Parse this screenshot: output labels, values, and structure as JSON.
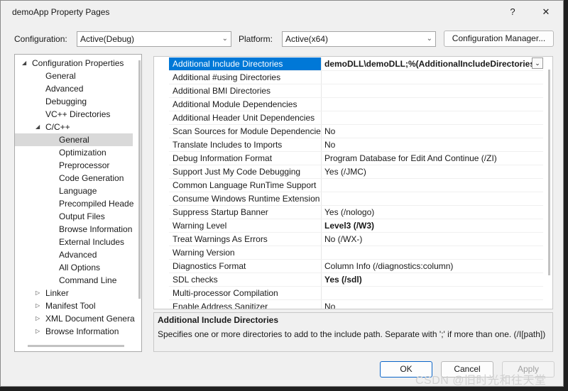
{
  "window": {
    "title": "demoApp Property Pages",
    "help_glyph": "?",
    "close_glyph": "✕"
  },
  "top": {
    "configuration_label": "Configuration:",
    "configuration_value": "Active(Debug)",
    "platform_label": "Platform:",
    "platform_value": "Active(x64)",
    "config_manager_label": "Configuration Manager..."
  },
  "tree": [
    {
      "label": "Configuration Properties",
      "level": 0,
      "expander": "down"
    },
    {
      "label": "General",
      "level": 1
    },
    {
      "label": "Advanced",
      "level": 1
    },
    {
      "label": "Debugging",
      "level": 1
    },
    {
      "label": "VC++ Directories",
      "level": 1
    },
    {
      "label": "C/C++",
      "level": 1,
      "expander": "down"
    },
    {
      "label": "General",
      "level": 2,
      "selected": true
    },
    {
      "label": "Optimization",
      "level": 2
    },
    {
      "label": "Preprocessor",
      "level": 2
    },
    {
      "label": "Code Generation",
      "level": 2
    },
    {
      "label": "Language",
      "level": 2
    },
    {
      "label": "Precompiled Heade",
      "level": 2
    },
    {
      "label": "Output Files",
      "level": 2
    },
    {
      "label": "Browse Information",
      "level": 2
    },
    {
      "label": "External Includes",
      "level": 2
    },
    {
      "label": "Advanced",
      "level": 2
    },
    {
      "label": "All Options",
      "level": 2
    },
    {
      "label": "Command Line",
      "level": 2
    },
    {
      "label": "Linker",
      "level": 1,
      "expander": "right"
    },
    {
      "label": "Manifest Tool",
      "level": 1,
      "expander": "right"
    },
    {
      "label": "XML Document Genera",
      "level": 1,
      "expander": "right"
    },
    {
      "label": "Browse Information",
      "level": 1,
      "expander": "right"
    }
  ],
  "properties": [
    {
      "name": "Additional Include Directories",
      "value": "demoDLL\\demoDLL;%(AdditionalIncludeDirectories)",
      "bold": true,
      "selected": true
    },
    {
      "name": "Additional #using Directories",
      "value": ""
    },
    {
      "name": "Additional BMI Directories",
      "value": ""
    },
    {
      "name": "Additional Module Dependencies",
      "value": ""
    },
    {
      "name": "Additional Header Unit Dependencies",
      "value": ""
    },
    {
      "name": "Scan Sources for Module Dependencies",
      "value": "No"
    },
    {
      "name": "Translate Includes to Imports",
      "value": "No"
    },
    {
      "name": "Debug Information Format",
      "value": "Program Database for Edit And Continue (/ZI)"
    },
    {
      "name": "Support Just My Code Debugging",
      "value": "Yes (/JMC)"
    },
    {
      "name": "Common Language RunTime Support",
      "value": ""
    },
    {
      "name": "Consume Windows Runtime Extension",
      "value": ""
    },
    {
      "name": "Suppress Startup Banner",
      "value": "Yes (/nologo)"
    },
    {
      "name": "Warning Level",
      "value": "Level3 (/W3)",
      "bold": true
    },
    {
      "name": "Treat Warnings As Errors",
      "value": "No (/WX-)"
    },
    {
      "name": "Warning Version",
      "value": ""
    },
    {
      "name": "Diagnostics Format",
      "value": "Column Info (/diagnostics:column)"
    },
    {
      "name": "SDL checks",
      "value": "Yes (/sdl)",
      "bold": true
    },
    {
      "name": "Multi-processor Compilation",
      "value": ""
    },
    {
      "name": "Enable Address Sanitizer",
      "value": "No"
    }
  ],
  "description": {
    "title": "Additional Include Directories",
    "text": "Specifies one or more directories to add to the include path. Separate with ';' if more than one. (/I[path])"
  },
  "buttons": {
    "ok": "OK",
    "cancel": "Cancel",
    "apply": "Apply"
  },
  "watermark": "CSDN @旧时光和往天堂",
  "colors": {
    "selection": "#0078d7",
    "tree_selection": "#d9d9d9"
  }
}
